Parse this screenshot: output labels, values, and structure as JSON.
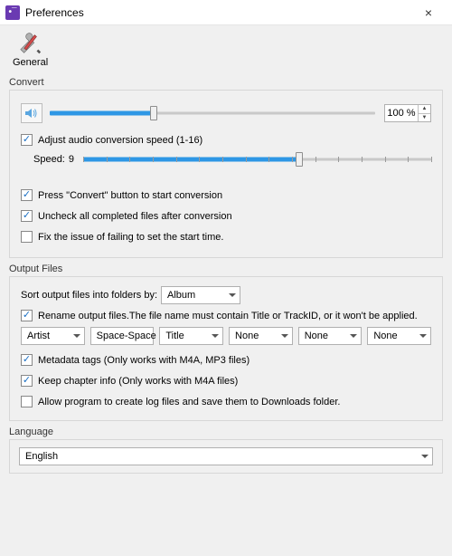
{
  "window": {
    "title": "Preferences",
    "close_label": "×"
  },
  "tabs": {
    "general": {
      "label": "General"
    }
  },
  "convert": {
    "header": "Convert",
    "volume_percent": "100 %",
    "volume_position_pct": 32,
    "adjust_speed_label": "Adjust audio conversion speed (1-16)",
    "adjust_speed_checked": true,
    "speed_label": "Speed:",
    "speed_value": "9",
    "speed_position_pct": 62,
    "press_convert_label": "Press \"Convert\" button to start conversion",
    "press_convert_checked": true,
    "uncheck_completed_label": "Uncheck all completed files after conversion",
    "uncheck_completed_checked": true,
    "fix_start_time_label": "Fix the issue of failing to set the start time.",
    "fix_start_time_checked": false
  },
  "output": {
    "header": "Output Files",
    "sort_label": "Sort output files into folders by:",
    "sort_value": "Album",
    "rename_label": "Rename output files.The file name must contain Title or TrackID, or it won't be applied.",
    "rename_checked": true,
    "parts": [
      "Artist",
      "Space-Space",
      "Title",
      "None",
      "None",
      "None"
    ],
    "metadata_label": "Metadata tags (Only works with M4A, MP3 files)",
    "metadata_checked": true,
    "chapter_label": "Keep chapter info (Only works with M4A files)",
    "chapter_checked": true,
    "log_label": "Allow program to create log files and save them to Downloads folder.",
    "log_checked": false
  },
  "language": {
    "header": "Language",
    "value": "English"
  }
}
